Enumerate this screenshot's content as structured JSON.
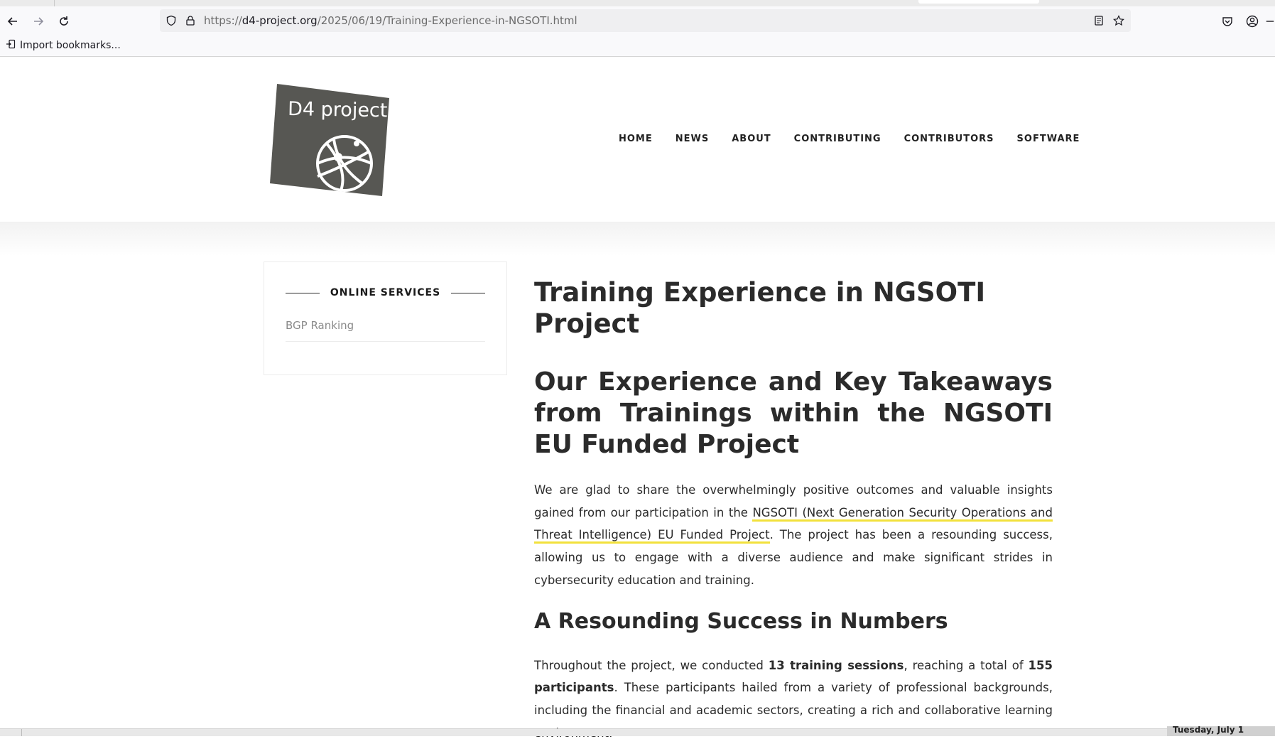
{
  "browser": {
    "url_prefix": "https://",
    "url_domain": "d4-project.org",
    "url_path": "/2025/06/19/Training-Experience-in-NGSOTI.html",
    "bookmarks_label": "Import bookmarks..."
  },
  "site": {
    "logo_text": "D4 project",
    "nav": [
      "HOME",
      "NEWS",
      "ABOUT",
      "CONTRIBUTING",
      "CONTRIBUTORS",
      "SOFTWARE"
    ]
  },
  "sidebar": {
    "title": "ONLINE SERVICES",
    "links": [
      "BGP Ranking"
    ]
  },
  "article": {
    "title": "Training Experience in NGSOTI Project",
    "subtitle": "Our Experience and Key Takeaways from Trainings within the NGSOTI EU Funded Project",
    "intro_before": "We are glad to share the overwhelmingly positive outcomes and valuable insights gained from our participation in the ",
    "intro_link": "NGSOTI (Next Generation Security Operations and Threat Intelligence) EU Funded Project",
    "intro_after": ". The project has been a resounding success, allowing us to engage with a diverse audience and make significant strides in cybersecurity education and training.",
    "section_heading": "A Resounding Success in Numbers",
    "numbers_p1": "Throughout the project, we conducted ",
    "numbers_b1": "13 training sessions",
    "numbers_p2": ", reaching a total of ",
    "numbers_b2": "155 participants",
    "numbers_p3": ". These participants hailed from a variety of professional backgrounds, including the financial and academic sectors, creating a rich and collaborative learning environment."
  },
  "taskbar": {
    "date": "Tuesday, July 1"
  },
  "colors": {
    "link_underline": "#f2e13c",
    "logo_bg": "#575753",
    "text": "#2b2b2b"
  },
  "icons": [
    "back-icon",
    "forward-icon",
    "reload-icon",
    "shield-icon",
    "lock-icon",
    "reader-view-icon",
    "star-icon",
    "pocket-icon",
    "account-icon",
    "import-icon"
  ]
}
